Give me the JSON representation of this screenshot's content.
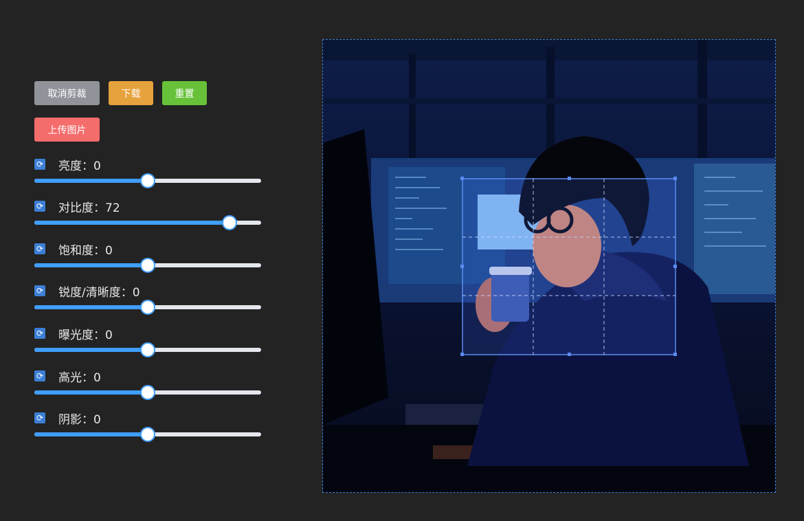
{
  "toolbar": {
    "cancel_crop": "取消剪裁",
    "download": "下载",
    "reset": "重置",
    "upload": "上传图片"
  },
  "controls": [
    {
      "label": "亮度：0",
      "value": 0,
      "min": -100,
      "max": 100
    },
    {
      "label": "对比度：72",
      "value": 72,
      "min": -100,
      "max": 100
    },
    {
      "label": "饱和度：0",
      "value": 0,
      "min": -100,
      "max": 100
    },
    {
      "label": "锐度/清晰度：0",
      "value": 0,
      "min": -100,
      "max": 100
    },
    {
      "label": "曝光度：0",
      "value": 0,
      "min": -100,
      "max": 100
    },
    {
      "label": "高光：0",
      "value": 0,
      "min": -100,
      "max": 100
    },
    {
      "label": "阴影：0",
      "value": 0,
      "min": -100,
      "max": 100
    }
  ],
  "colors": {
    "accent": "#409eff",
    "cancel": "#909399",
    "download": "#e6a23c",
    "reset": "#67c23a",
    "upload": "#f56c6c"
  },
  "canvas": {
    "image_icon": "illustration-of-person-with-coffee-at-computer",
    "crop_box": "crop-selection"
  }
}
